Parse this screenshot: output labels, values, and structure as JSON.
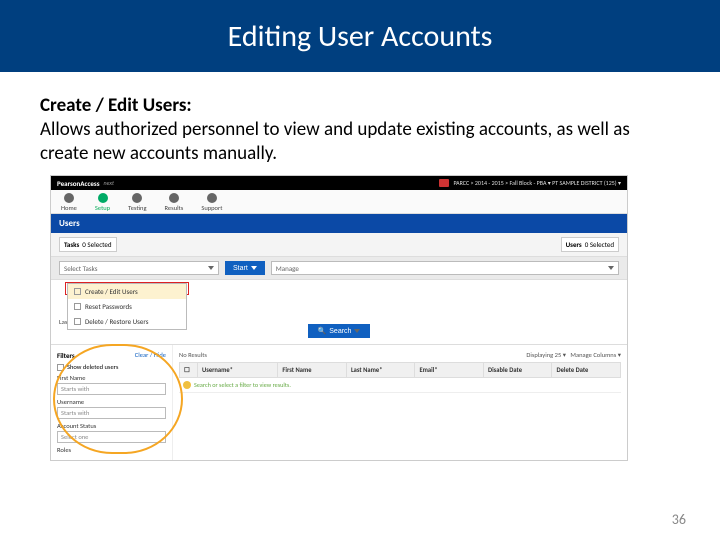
{
  "slide": {
    "title": "Editing User Accounts",
    "heading": "Create / Edit Users:",
    "body": "Allows authorized personnel to view and update existing accounts, as well as create new accounts manually.",
    "page_number": "36"
  },
  "app": {
    "brand": "PearsonAccess",
    "brand_suffix": "next",
    "context": "PARCC > 2014 - 2015 > Fall Block - PBA ▾   PT SAMPLE DISTRICT (125) ▾",
    "tabs": {
      "home": "Home",
      "setup": "Setup",
      "testing": "Testing",
      "results": "Results",
      "support": "Support"
    },
    "section_title": "Users",
    "tasks": {
      "label": "Tasks",
      "count": "0 Selected"
    },
    "users_sel": {
      "label": "Users",
      "count": "0 Selected"
    },
    "select_tasks_placeholder": "Select Tasks",
    "start_btn": "Start",
    "manage_placeholder": "Manage",
    "dropdown": {
      "create_edit": "Create / Edit Users",
      "reset": "Reset Passwords",
      "delete_restore": "Delete / Restore Users"
    },
    "last_name_label": "Last Name starts with",
    "search_btn": "Search",
    "filters": {
      "title": "Filters",
      "clear": "Clear / Hide",
      "show_deleted": "Show deleted users",
      "first_name": "First Name",
      "starts_with": "Starts with",
      "username": "Username",
      "account_status": "Account Status",
      "select_one": "Select one",
      "roles": "Roles"
    },
    "results": {
      "no_results": "No Results",
      "displaying": "Displaying",
      "per_page": "25",
      "manage_cols": "Manage Columns ▾",
      "cols": {
        "username": "Username*",
        "first": "First Name",
        "last": "Last Name*",
        "email": "Email*",
        "disable": "Disable Date",
        "delete": "Delete Date"
      },
      "warn": "Search or select a filter to view results."
    }
  }
}
